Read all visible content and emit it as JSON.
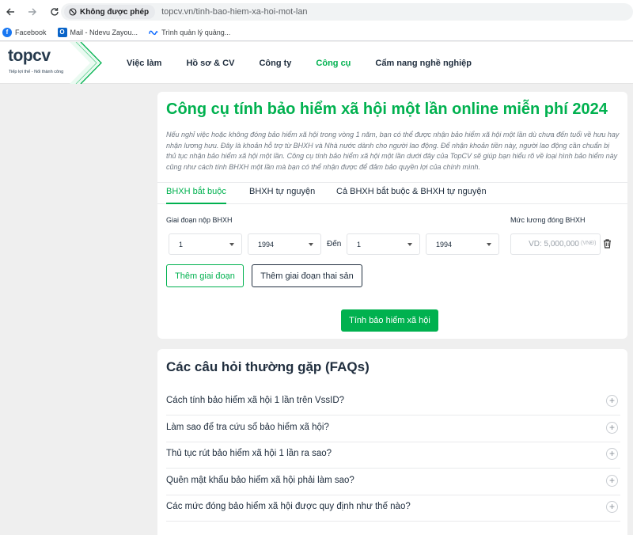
{
  "browser": {
    "security_label": "Không được phép",
    "url": "topcv.vn/tinh-bao-hiem-xa-hoi-mot-lan",
    "bookmarks": [
      {
        "label": "Facebook",
        "icon": "facebook-icon"
      },
      {
        "label": "Mail - Ndevu Zayou...",
        "icon": "outlook-icon"
      },
      {
        "label": "Trình quản lý quảng...",
        "icon": "meta-icon"
      }
    ]
  },
  "header": {
    "logo_main": "top",
    "logo_cv": "cv",
    "tagline": "Tiếp lợi thế - Nối thành công",
    "nav": [
      "Việc làm",
      "Hồ sơ & CV",
      "Công ty",
      "Công cụ",
      "Cẩm nang nghề nghiệp"
    ],
    "active_nav": "Công cụ"
  },
  "calculator": {
    "title": "Công cụ tính bảo hiểm xã hội một lần online miễn phí 2024",
    "intro": "Nếu nghỉ việc hoặc không đóng bảo hiểm xã hội trong vòng 1 năm, bạn có thể được nhận bảo hiểm xã hội một lần dù chưa đến tuổi về hưu hay nhận lương hưu. Đây là khoản hỗ trợ từ BHXH và Nhà nước dành cho người lao động. Để nhận khoản tiền này, người lao động cần chuẩn bị thủ tục nhận bảo hiểm xã hội một lần. Công cụ tính bảo hiểm xã hội một lần dưới đây của TopCV sẽ giúp bạn hiểu rõ về loại hình bảo hiểm này cũng như cách tính BHXH một lần mà bạn có thể nhận được để đảm bảo quyền lợi của chính mình.",
    "tabs": [
      "BHXH bắt buộc",
      "BHXH tự nguyện",
      "Cả BHXH bắt buộc & BHXH tự nguyện"
    ],
    "period_label": "Giai đoạn nộp BHXH",
    "salary_label": "Mức lương đóng BHXH",
    "from_month": "1",
    "from_year": "1994",
    "to_label": "Đến",
    "to_month": "1",
    "to_year": "1994",
    "salary_placeholder": "VD: 5,000,000",
    "salary_unit": "(VNĐ)",
    "add_period_button": "Thêm giai đoạn",
    "add_maternity_button": "Thêm giai đoạn thai sản",
    "calculate_button": "Tính bảo hiểm xã hội"
  },
  "faq": {
    "title": "Các câu hỏi thường gặp (FAQs)",
    "items": [
      "Cách tính bảo hiểm xã hội 1 lần trên VssID?",
      "Làm sao để tra cứu sổ bảo hiểm xã hội?",
      "Thủ tục rút bảo hiểm xã hội 1 lần ra sao?",
      "Quên mật khẩu bảo hiểm xã hội phải làm sao?",
      "Các mức đóng bảo hiểm xã hội được quy định như thế nào?"
    ],
    "expand_symbol": "+"
  },
  "colors": {
    "brand_green": "#00b14f",
    "text_dark": "#212f3f",
    "page_bg": "#efefef"
  }
}
